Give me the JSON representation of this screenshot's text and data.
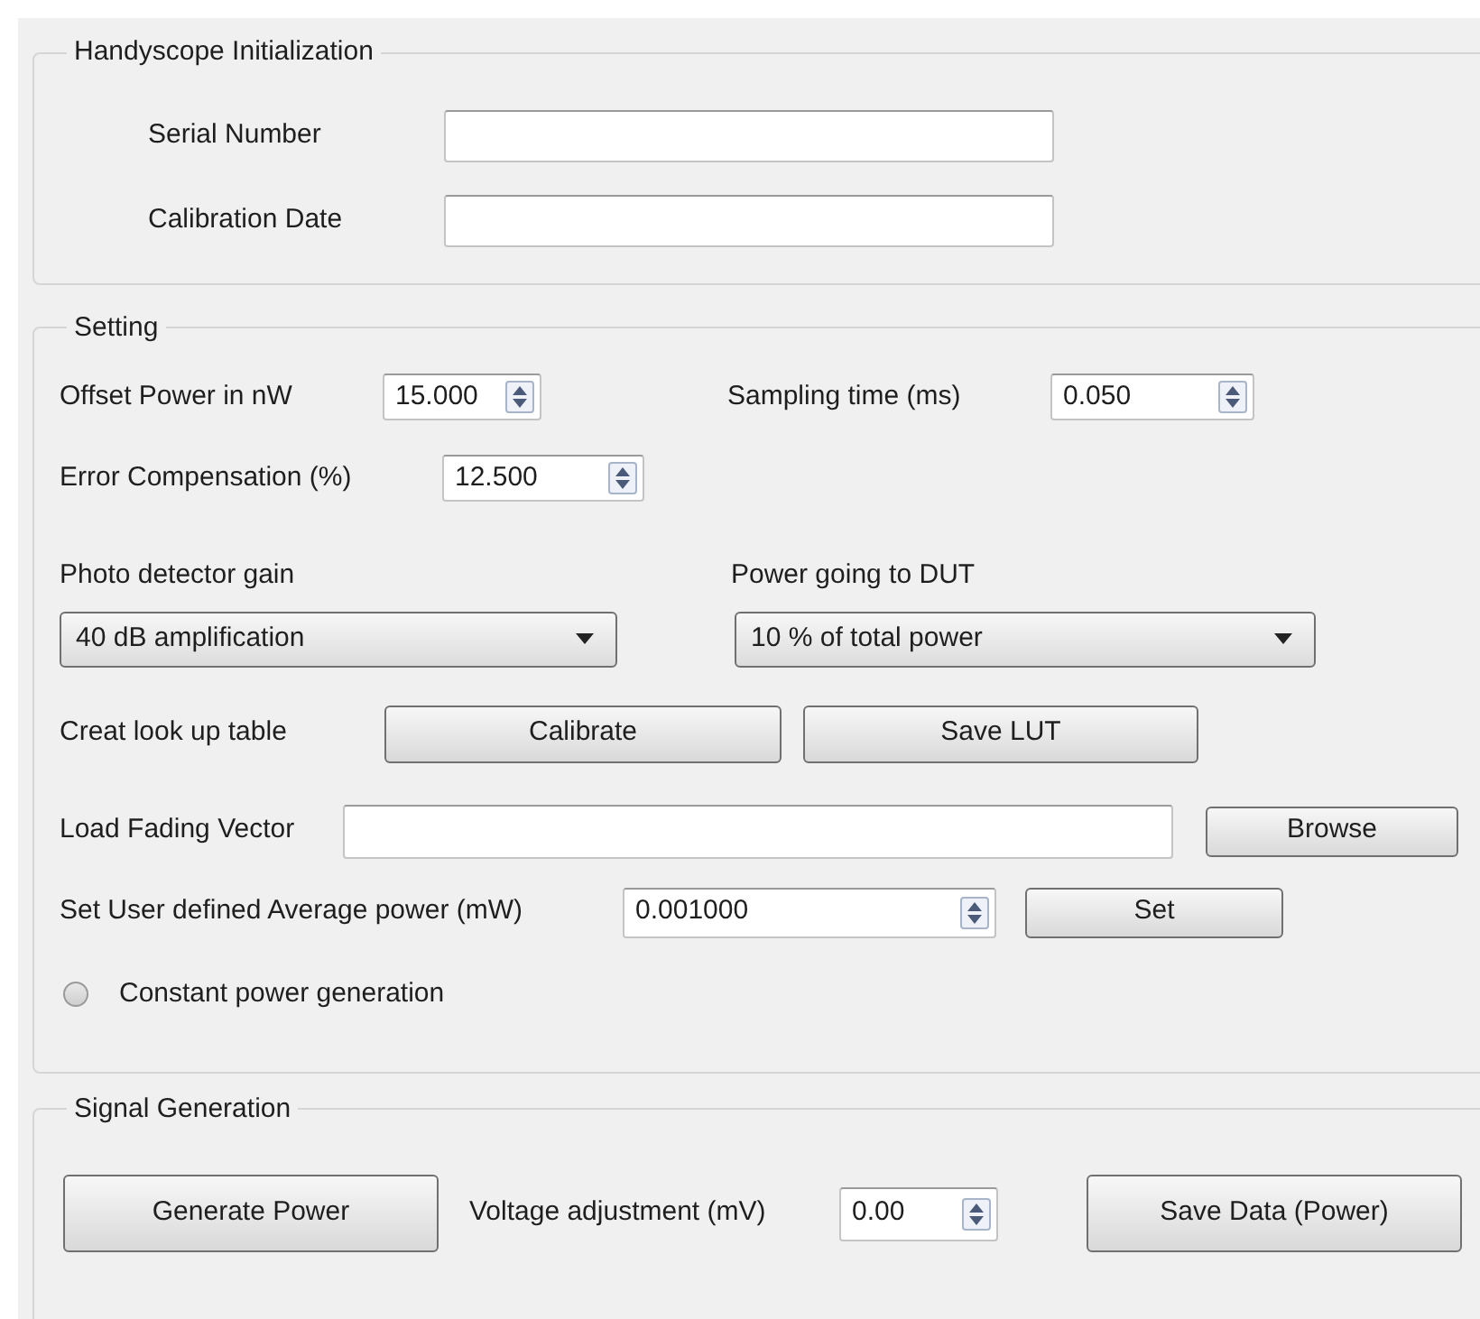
{
  "handyscope_initialization": {
    "title": "Handyscope Initialization",
    "serial_number": {
      "label": "Serial Number"
    },
    "calibration_date": {
      "label": "Calibration Date"
    }
  },
  "setting": {
    "title": "Setting",
    "offset_power": {
      "label": "Offset Power in nW",
      "value": "15.000"
    },
    "sampling_time": {
      "label": "Sampling time (ms)",
      "value": "0.050"
    },
    "error_compensation": {
      "label": "Error Compensation (%)",
      "value": "12.500"
    },
    "photo_detector_gain": {
      "label": "Photo detector gain",
      "value": "40 dB amplification"
    },
    "power_going_to_dut": {
      "label": "Power going to DUT",
      "value": "10 % of total power"
    },
    "lookup_table": {
      "label": "Creat look up table",
      "buttons": [
        "Calibrate",
        "Save LUT"
      ]
    },
    "fading_vector": {
      "label": "Load Fading Vector",
      "button": "Browse"
    },
    "average_power": {
      "label": "Set User defined Average power (mW)",
      "value": "0.001000",
      "button": "Set"
    },
    "constant_power": {
      "label": "Constant power generation",
      "checked": false
    }
  },
  "signal_generation": {
    "title": "Signal Generation",
    "generate_button": "Generate Power",
    "voltage": {
      "label": "Voltage adjustment (mV)",
      "value": "0.00"
    },
    "save_button": "Save Data (Power)"
  }
}
